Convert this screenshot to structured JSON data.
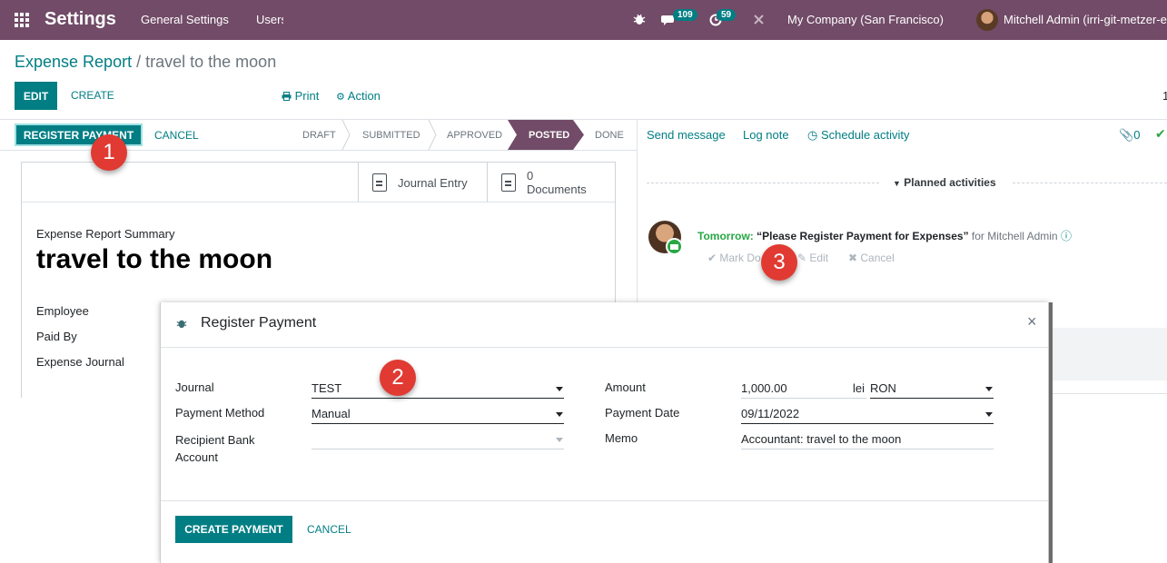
{
  "topbar": {
    "brand": "Settings",
    "nav": [
      "General Settings",
      "Users"
    ],
    "messages_count": "109",
    "activities_count": "59",
    "company": "My Company (San Francisco)",
    "user": "Mitchell Admin (irri-git-metzer-e"
  },
  "breadcrumb": {
    "parent": "Expense Report",
    "separator": "/",
    "current": "travel to the moon"
  },
  "control_panel": {
    "edit": "EDIT",
    "create": "CREATE",
    "print": "Print",
    "action": "Action",
    "pager": "1"
  },
  "statusbar": {
    "register_payment": "REGISTER PAYMENT",
    "cancel": "CANCEL",
    "stages": [
      "DRAFT",
      "SUBMITTED",
      "APPROVED",
      "POSTED",
      "DONE"
    ],
    "active_stage": "POSTED"
  },
  "smart_buttons": {
    "journal_entry": "Journal Entry",
    "documents_count": "0",
    "documents_label": "Documents"
  },
  "sheet": {
    "summary_label": "Expense Report Summary",
    "title": "travel to the moon",
    "fields": [
      "Employee",
      "Paid By",
      "Expense Journal"
    ]
  },
  "chatter": {
    "send_message": "Send message",
    "log_note": "Log note",
    "schedule_activity": "Schedule activity",
    "attachments": "0",
    "planned_activities": "Planned activities",
    "activity_when": "Tomorrow:",
    "activity_summary": "“Please Register Payment for Expenses”",
    "activity_for": "for Mitchell Admin",
    "mark_done": "Mark Do",
    "edit": "Edit",
    "cancel": "Cancel"
  },
  "modal": {
    "title": "Register Payment",
    "journal_label": "Journal",
    "journal_value": "TEST",
    "payment_method_label": "Payment Method",
    "payment_method_value": "Manual",
    "recipient_bank_label_1": "Recipient Bank",
    "recipient_bank_label_2": "Account",
    "amount_label": "Amount",
    "amount_value": "1,000.00",
    "currency_symbol": "lei",
    "currency": "RON",
    "payment_date_label": "Payment Date",
    "payment_date_value": "09/11/2022",
    "memo_label": "Memo",
    "memo_value": "Accountant: travel to the moon",
    "create_payment": "CREATE PAYMENT",
    "cancel": "CANCEL"
  },
  "callouts": [
    "1",
    "2",
    "3"
  ],
  "colors": {
    "primary": "#017e84",
    "brand_bar": "#714b67",
    "activity_green": "#28a745",
    "callout_red": "#e03a32"
  }
}
